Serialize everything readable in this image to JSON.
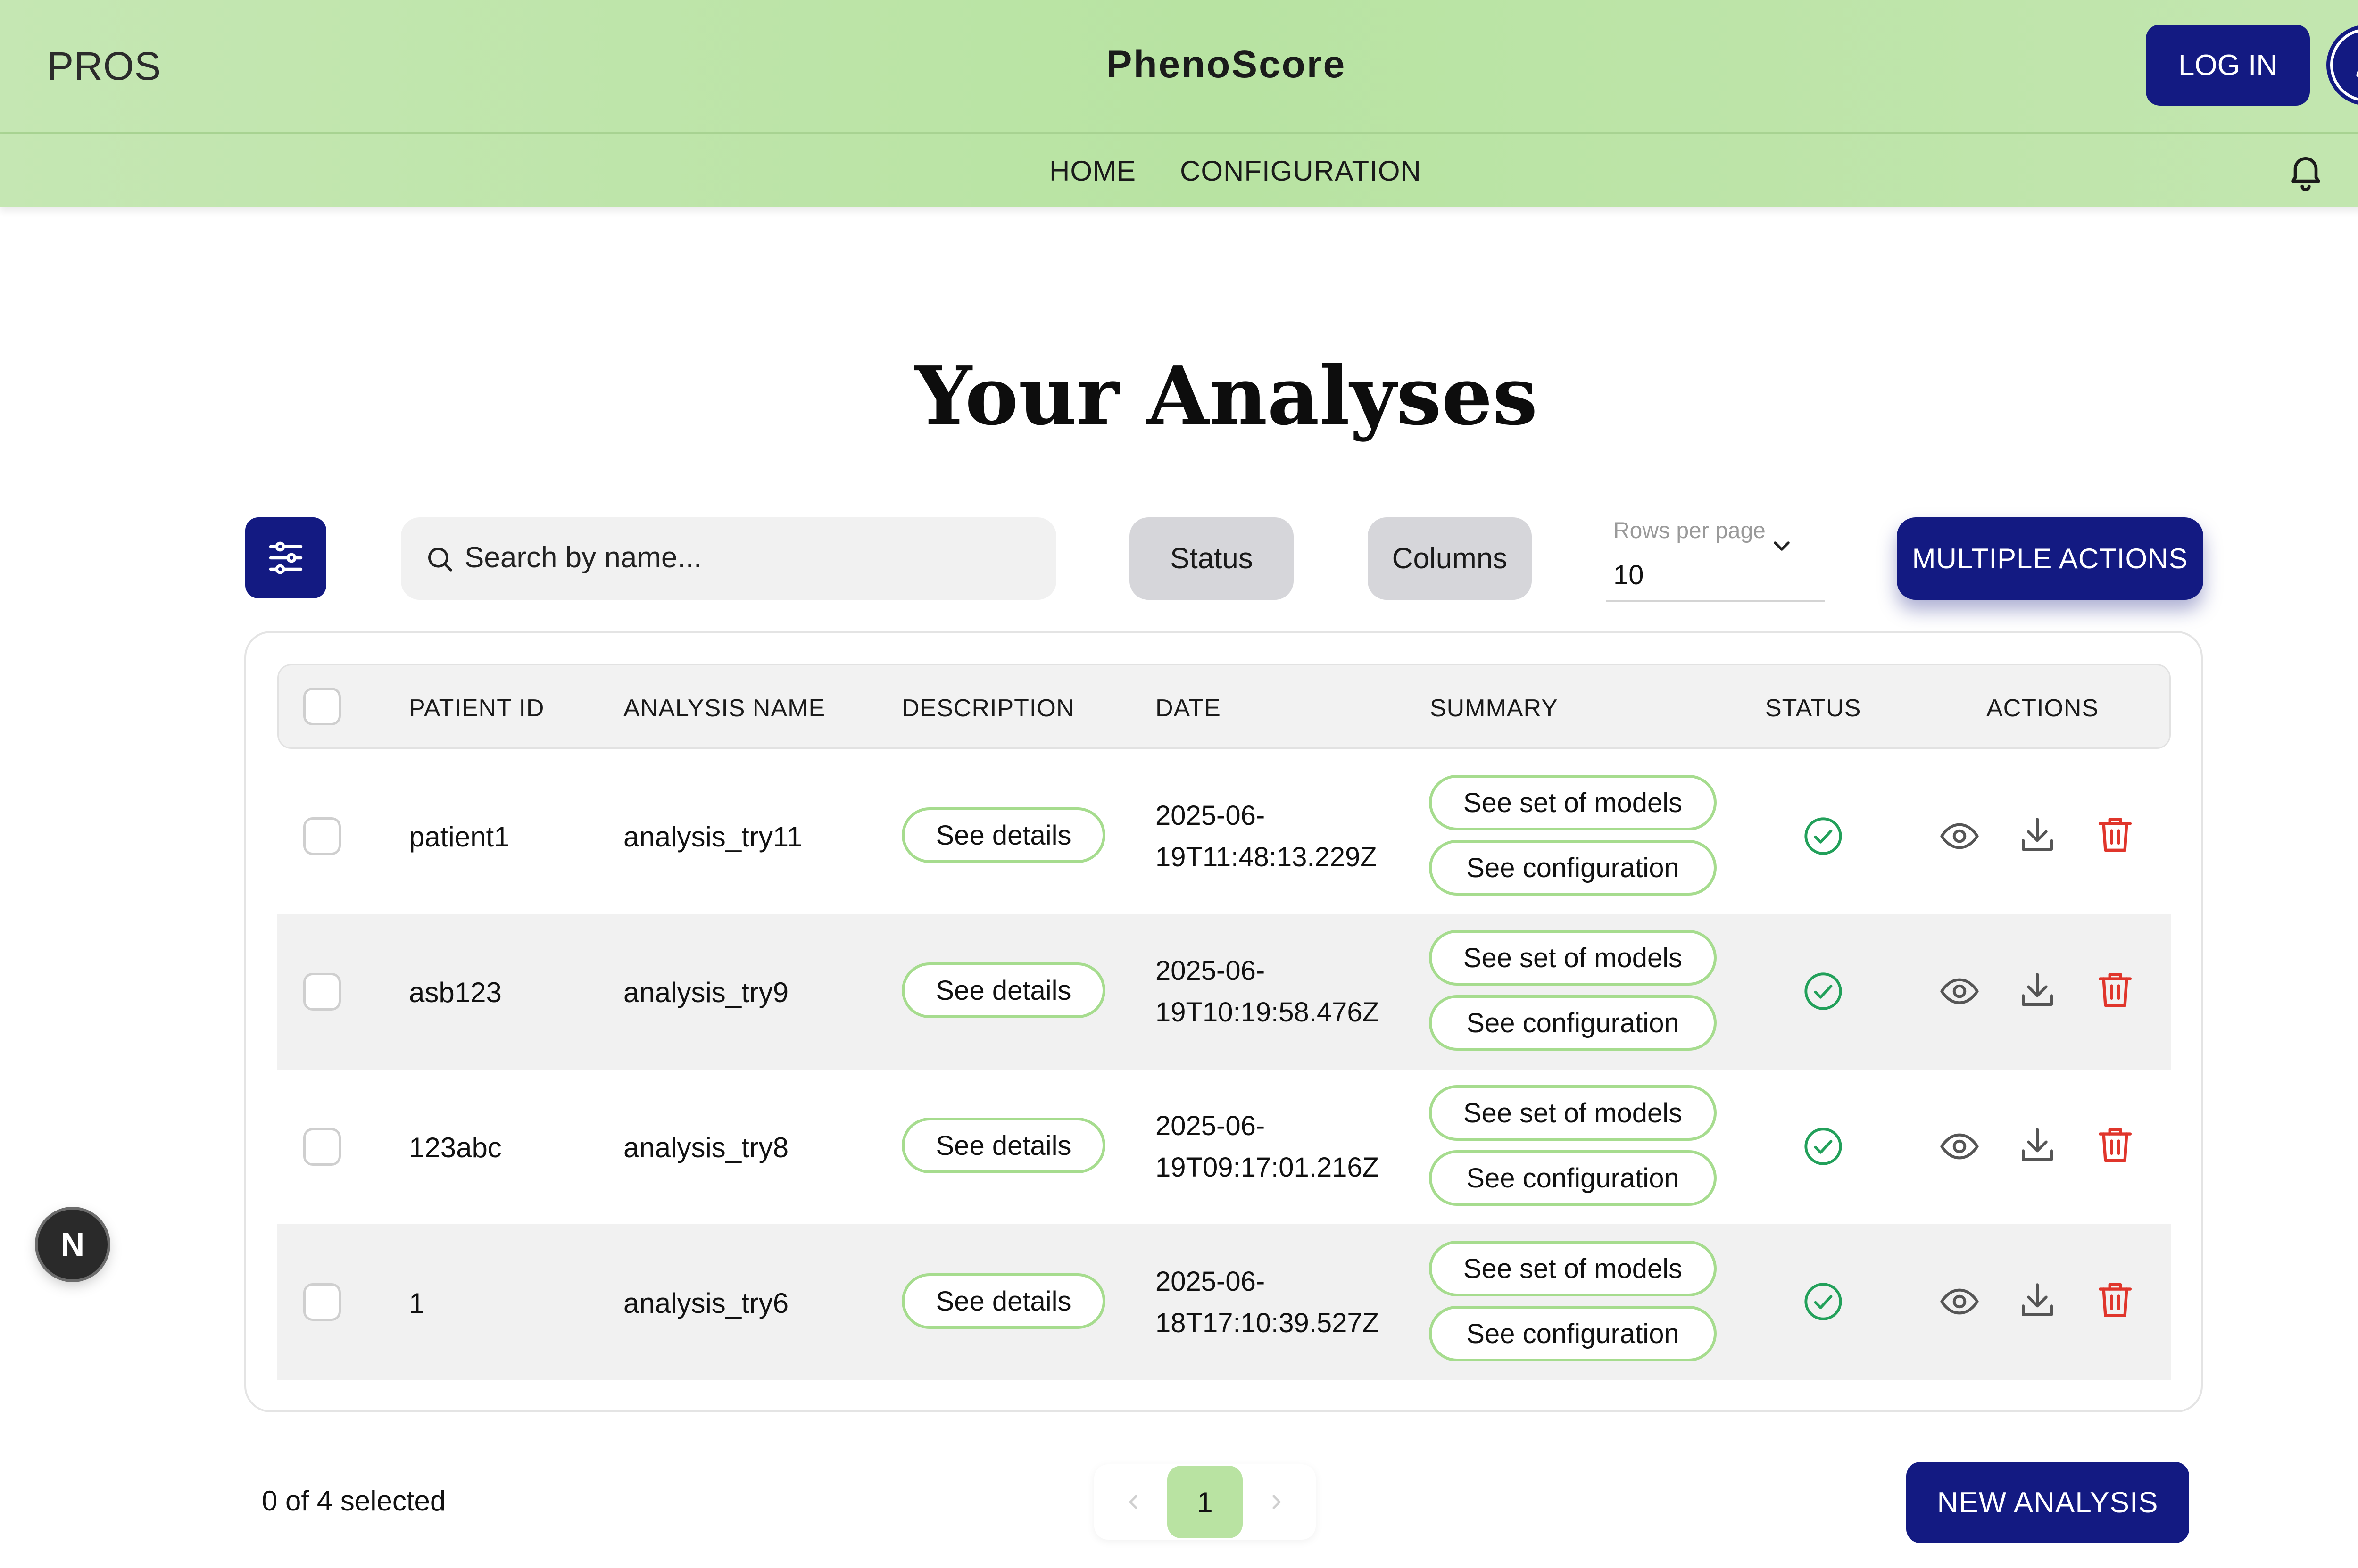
{
  "header": {
    "brand": "PROS",
    "app_title": "PhenoScore",
    "login_label": "LOG IN",
    "avatar_icon": "user-icon"
  },
  "nav": {
    "links": [
      "HOME",
      "CONFIGURATION"
    ],
    "notification_icon": "bell-icon",
    "help_icon": "help-icon"
  },
  "page": {
    "title": "Your Analyses"
  },
  "toolbar": {
    "filter_icon": "sliders-icon",
    "search_placeholder": "Search by name...",
    "status_label": "Status",
    "columns_label": "Columns",
    "rows_per_page_label": "Rows per page",
    "rows_per_page_value": "10",
    "multiple_actions_label": "MULTIPLE ACTIONS"
  },
  "table": {
    "columns": [
      "PATIENT ID",
      "ANALYSIS NAME",
      "DESCRIPTION",
      "DATE",
      "SUMMARY",
      "STATUS",
      "ACTIONS"
    ],
    "rows": [
      {
        "patient_id": "patient1",
        "analysis_name": "analysis_try11",
        "description": "See details",
        "date_line1": "2025-06-",
        "date_line2": "19T11:48:13.229Z",
        "summary_models": "See set of models",
        "summary_config": "See configuration",
        "status": "completed"
      },
      {
        "patient_id": "asb123",
        "analysis_name": "analysis_try9",
        "description": "See details",
        "date_line1": "2025-06-",
        "date_line2": "19T10:19:58.476Z",
        "summary_models": "See set of models",
        "summary_config": "See configuration",
        "status": "completed"
      },
      {
        "patient_id": "123abc",
        "analysis_name": "analysis_try8",
        "description": "See details",
        "date_line1": "2025-06-",
        "date_line2": "19T09:17:01.216Z",
        "summary_models": "See set of models",
        "summary_config": "See configuration",
        "status": "completed"
      },
      {
        "patient_id": "1",
        "analysis_name": "analysis_try6",
        "description": "See details",
        "date_line1": "2025-06-",
        "date_line2": "18T17:10:39.527Z",
        "summary_models": "See set of models",
        "summary_config": "See configuration",
        "status": "completed"
      }
    ]
  },
  "footer": {
    "selection_text": "0 of 4 selected",
    "current_page": "1",
    "new_analysis_label": "NEW ANALYSIS"
  },
  "dev_badge": "N",
  "colors": {
    "header_green": "#b8e3a2",
    "primary_navy": "#131a82",
    "pill_border": "#a6dc8e",
    "status_green": "#22a05a",
    "delete_red": "#e0352b"
  }
}
